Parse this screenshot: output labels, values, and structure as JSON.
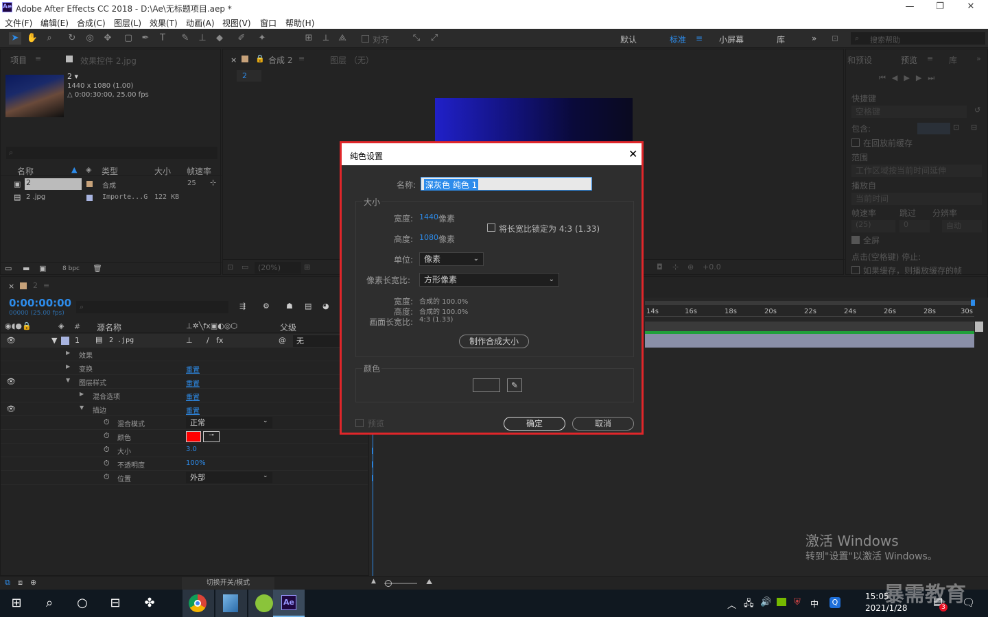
{
  "titlebar": {
    "logo": "Ae",
    "title": "Adobe After Effects CC 2018 - D:\\Ae\\无标题项目.aep *"
  },
  "menu": [
    "文件(F)",
    "编辑(E)",
    "合成(C)",
    "图层(L)",
    "效果(T)",
    "动画(A)",
    "视图(V)",
    "窗口",
    "帮助(H)"
  ],
  "toolbar": {
    "snap_label": "对齐",
    "workspaces": [
      "默认",
      "标准",
      "小屏幕",
      "库"
    ],
    "active_workspace": "标准",
    "search_placeholder": "搜索帮助"
  },
  "project": {
    "tab": "项目",
    "effects_tab": "效果控件 2.jpg",
    "item_name": "2 ▾",
    "item_info1": "1440 x 1080 (1.00)",
    "item_info2": "△ 0:00:30:00, 25.00 fps",
    "search_icon": "search-icon",
    "columns": [
      "名称",
      "类型",
      "大小",
      "帧速率"
    ],
    "rows": [
      {
        "name": "2",
        "type": "合成",
        "size": "",
        "fps": "25"
      },
      {
        "name": "2 .jpg",
        "type": "Importe...G",
        "size": "122 KB",
        "fps": ""
      }
    ],
    "bpc": "8 bpc"
  },
  "comp": {
    "tab": "合成 2",
    "layer_tab": "图层 （无）",
    "sub_tab": "2",
    "zoom": "(20%)",
    "exposure": "+0.0"
  },
  "preview": {
    "tab1": "和预设",
    "tab2": "预览",
    "tab3": "库",
    "shortcut_label": "快捷键",
    "shortcut_value": "空格键",
    "include_label": "包含:",
    "cache_before": "在回放前缓存",
    "range_label": "范围",
    "range_value": "工作区域按当前时间延伸",
    "play_from_label": "播放自",
    "play_from_value": "当前时间",
    "fps_label": "帧速率",
    "skip_label": "跳过",
    "res_label": "分辨率",
    "fps_value": "(25)",
    "skip_value": "0",
    "res_value": "自动",
    "fullscreen": "全屏",
    "stop_label": "点击(空格键) 停止:",
    "stop_option": "如果缓存，则播放缓存的帧"
  },
  "timeline": {
    "tab": "2",
    "timecode": "0:00:00:00",
    "timecode_sub": "00000 (25.00 fps)",
    "col_source": "源名称",
    "col_parent": "父级",
    "layer_num": "1",
    "layer_name": "2 .jpg",
    "parent_value": "无",
    "props": [
      {
        "name": "效果",
        "reset": ""
      },
      {
        "name": "变换",
        "reset": "重置"
      },
      {
        "name": "图层样式",
        "reset": "重置"
      },
      {
        "name": "混合选项",
        "reset": "重置"
      },
      {
        "name": "描边",
        "reset": "重置"
      }
    ],
    "stroke": [
      {
        "name": "混合模式",
        "value": "正常"
      },
      {
        "name": "颜色",
        "value": ""
      },
      {
        "name": "大小",
        "value": "3.0"
      },
      {
        "name": "不透明度",
        "value": "100%"
      },
      {
        "name": "位置",
        "value": "外部"
      }
    ],
    "ruler": [
      "14s",
      "16s",
      "18s",
      "20s",
      "22s",
      "24s",
      "26s",
      "28s",
      "30s"
    ],
    "toggle_label": "切换开关/模式"
  },
  "dialog": {
    "title": "纯色设置",
    "name_label": "名称:",
    "name_value": "深灰色 纯色 1",
    "size_group": "大小",
    "width_label": "宽度:",
    "width_value": "1440",
    "height_label": "高度:",
    "height_value": "1080",
    "px_unit": "像素",
    "lock_label": "将长宽比锁定为 4:3 (1.33)",
    "unit_label": "单位:",
    "unit_value": "像素",
    "par_label": "像素长宽比:",
    "par_value": "方形像素",
    "w_pct_label": "宽度:",
    "w_pct_value": "合成的 100.0%",
    "h_pct_label": "高度:",
    "h_pct_value": "合成的 100.0%",
    "far_label": "画面长宽比:",
    "far_value": "4:3 (1.33)",
    "make_comp_size": "制作合成大小",
    "color_group": "颜色",
    "preview_label": "预览",
    "ok": "确定",
    "cancel": "取消",
    "swatch_color": "#2e2e2e"
  },
  "watermark": {
    "line1": "激活 Windows",
    "line2": "转到\"设置\"以激活 Windows。",
    "brand": "暴需教育"
  },
  "taskbar": {
    "time": "15:05",
    "date": "2021/1/28",
    "ime": "中",
    "badge": "3"
  }
}
